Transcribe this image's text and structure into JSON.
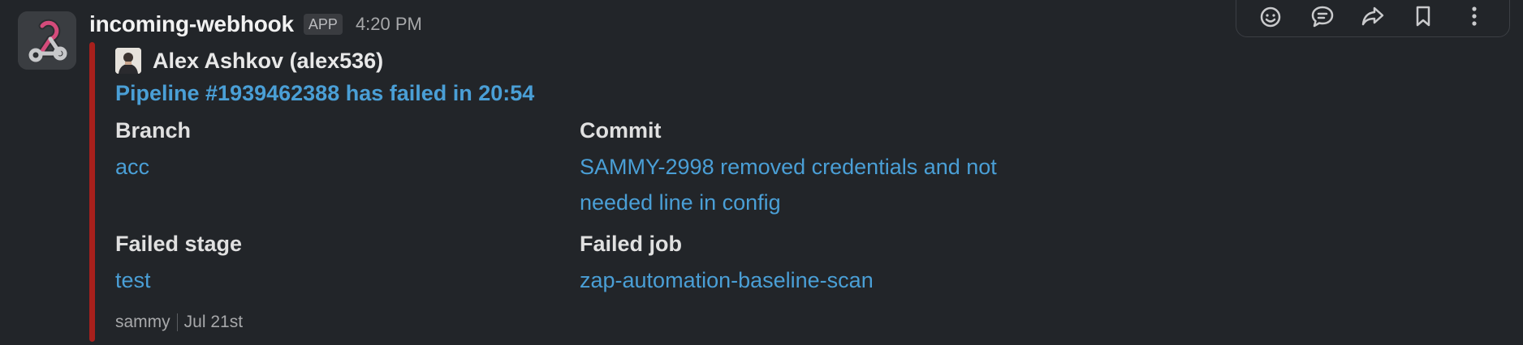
{
  "message": {
    "app_name": "incoming-webhook",
    "app_badge": "APP",
    "time": "4:20 PM"
  },
  "toolbar": {
    "icons": [
      "emoji-reaction-icon",
      "reply-thread-icon",
      "share-forward-icon",
      "bookmark-icon",
      "more-actions-icon"
    ]
  },
  "attachment": {
    "accent_color": "#a8201c",
    "author": "Alex Ashkov (alex536)",
    "title": "Pipeline #1939462388 has failed in 20:54",
    "fields": {
      "branch_label": "Branch",
      "branch_value": "acc",
      "commit_label": "Commit",
      "commit_value_line1": "SAMMY-2998 removed credentials and not",
      "commit_value_line2": "needed line in config",
      "failed_stage_label": "Failed stage",
      "failed_stage_value": "test",
      "failed_job_label": "Failed job",
      "failed_job_value": "zap-automation-baseline-scan"
    },
    "footer_source": "sammy",
    "footer_date": "Jul 21st"
  },
  "colors": {
    "background": "#222529",
    "link": "#4a9fd6",
    "webhook_pink": "#d54b7b"
  }
}
